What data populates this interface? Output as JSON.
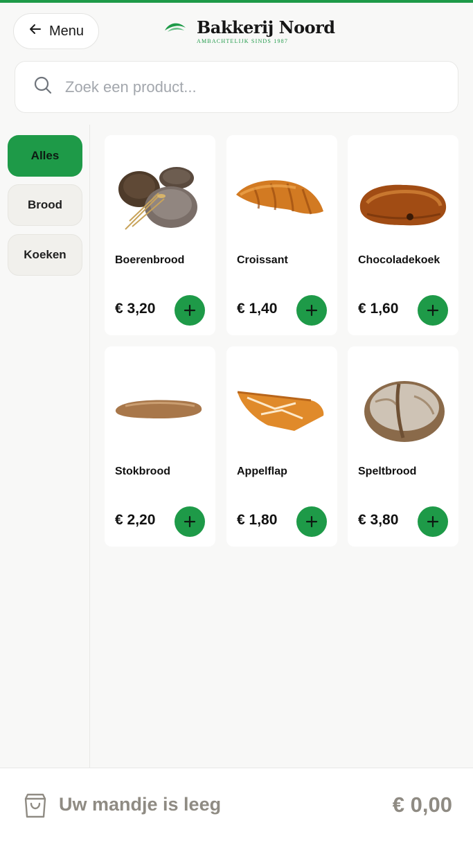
{
  "header": {
    "back_label": "Menu",
    "brand_name": "Bakkerij Noord",
    "brand_tagline": "AMBACHTELIJK SINDS 1987",
    "accent_color": "#1e9a48"
  },
  "search": {
    "placeholder": "Zoek een product..."
  },
  "categories": [
    {
      "label": "Alles",
      "active": true
    },
    {
      "label": "Brood",
      "active": false
    },
    {
      "label": "Koeken",
      "active": false
    }
  ],
  "products": [
    {
      "name": "Boerenbrood",
      "price": "€ 3,20",
      "image": "boerenbrood-image"
    },
    {
      "name": "Croissant",
      "price": "€ 1,40",
      "image": "croissant-image"
    },
    {
      "name": "Chocoladekoek",
      "price": "€ 1,60",
      "image": "chocoladekoek-image"
    },
    {
      "name": "Stokbrood",
      "price": "€ 2,20",
      "image": "stokbrood-image"
    },
    {
      "name": "Appelflap",
      "price": "€ 1,80",
      "image": "appelflap-image"
    },
    {
      "name": "Speltbrood",
      "price": "€ 3,80",
      "image": "speltbrood-image"
    }
  ],
  "cart": {
    "status": "Uw mandje is leeg",
    "total": "€ 0,00"
  }
}
